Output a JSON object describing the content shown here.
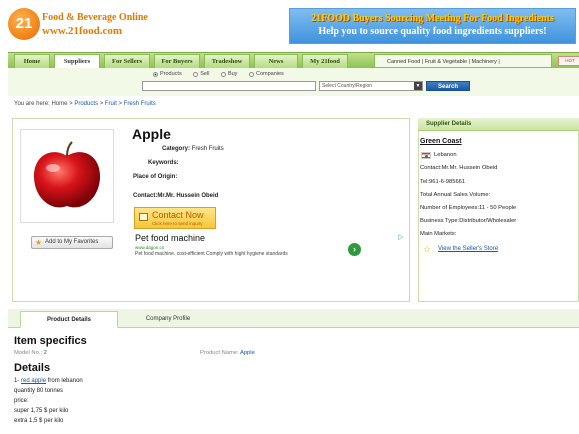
{
  "header": {
    "logo_badge": "21",
    "logo_name": "Food & Beverage Online",
    "logo_url": "www.21food.com",
    "banner_line1": "21FOOD Buyers Sourcing Meeting For Food Ingredients",
    "banner_line2": "Help you to source quality food ingredients suppliers!"
  },
  "nav": {
    "tabs": [
      "Home",
      "Suppliers",
      "For Sellers",
      "For Buyers",
      "Tradeshow",
      "News",
      "My 21food"
    ],
    "active_tab": "Suppliers",
    "right_links": "Canned Food | Fruit & Vegetable | Machinery |",
    "badge": "HOT"
  },
  "search": {
    "radios": [
      {
        "label": "Products",
        "selected": true
      },
      {
        "label": "Sell",
        "selected": false
      },
      {
        "label": "Buy",
        "selected": false
      },
      {
        "label": "Companies",
        "selected": false
      }
    ],
    "input_value": "",
    "select_value": "Select Country/Region",
    "button_label": "Search"
  },
  "breadcrumb": {
    "prefix": "You are here: Home >",
    "products": "Products",
    "sep1": ">",
    "fruit": "Fruit",
    "sep2": ">",
    "fresh_fruits": "Fresh Fruits"
  },
  "product": {
    "title": "Apple",
    "category_label": "Category:",
    "category_value": "Fresh Fruits",
    "keywords_label": "Keywords:",
    "place_label": "Place of Origin:",
    "contact_line": "Contact:Mr.Mr. Hussein Obeid",
    "contact_button": "Contact Now",
    "contact_sub": "Click here to send inquiry",
    "favorites_button": "Add to My Favorites",
    "ad": {
      "title": "Pet food machine",
      "url": "www.dagon.cn",
      "desc": "Pet food machine. cost-efficient Comply with hight hygiene standards",
      "go": "›",
      "choice": "▷"
    }
  },
  "supplier": {
    "heading": "Supplier Details",
    "name": "Green Coast",
    "country": "Lebanon",
    "lines": [
      "Contact:Mr.Mr. Hussein Obeid",
      "Tel:961-6-985661",
      "Total Annual Sales Volume:",
      "Number of Employees:11 - 50 People",
      "Business Type:Distributor/Wholesaler",
      "Main Markets:"
    ],
    "store_link": "View the Seller's Store"
  },
  "tabs": {
    "active": "Product Details",
    "inactive": "Company Profile"
  },
  "specs": {
    "heading": "Item specifics",
    "model_label": "Model No.:",
    "model_value": "2",
    "name_label": "Product Name:",
    "name_value": "Apple"
  },
  "details": {
    "heading": "Details",
    "line1_prefix": "1-",
    "line1_link": "red apple",
    "line1_suffix": "from lebanon",
    "lines": [
      "quantity 80 tonnes",
      "price:",
      "super 1,75 $ per kilo",
      "extra 1,5 $ per kilo"
    ]
  },
  "colors": {
    "brand_orange": "#e07b00",
    "nav_green": "#8ec254",
    "link_blue": "#1a55a8",
    "banner_blue": "#3f93dc"
  }
}
